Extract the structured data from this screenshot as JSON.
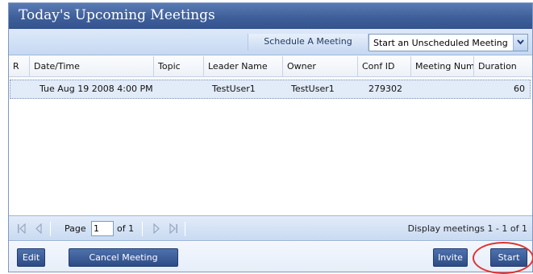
{
  "title": "Today's Upcoming Meetings",
  "toolbar": {
    "schedule_label": "Schedule A Meeting",
    "unscheduled_select": "Start an Unscheduled Meeting"
  },
  "table": {
    "columns": [
      "R",
      "Date/Time",
      "Topic",
      "Leader Name",
      "Owner",
      "Conf ID",
      "Meeting Num",
      "Duration"
    ],
    "rows": [
      {
        "r": "",
        "datetime": "Tue Aug 19 2008 4:00 PM",
        "topic": "",
        "leader": "TestUser1",
        "owner": "TestUser1",
        "conf_id": "279302",
        "meeting_num": "",
        "duration": "60"
      }
    ]
  },
  "pager": {
    "page_label": "Page",
    "page_value": "1",
    "of_label": "of 1",
    "display_text": "Display meetings 1 - 1 of 1"
  },
  "footer": {
    "edit_label": "Edit",
    "cancel_label": "Cancel Meeting",
    "invite_label": "Invite",
    "start_label": "Start"
  },
  "colors": {
    "title_bar": "#3f5f9a",
    "button": "#3a5a94",
    "selected_row": "#e2ebf8",
    "highlight_circle": "#e0322d"
  },
  "icons": [
    "first-page-icon",
    "prev-page-icon",
    "next-page-icon",
    "last-page-icon",
    "chevron-down-icon"
  ]
}
